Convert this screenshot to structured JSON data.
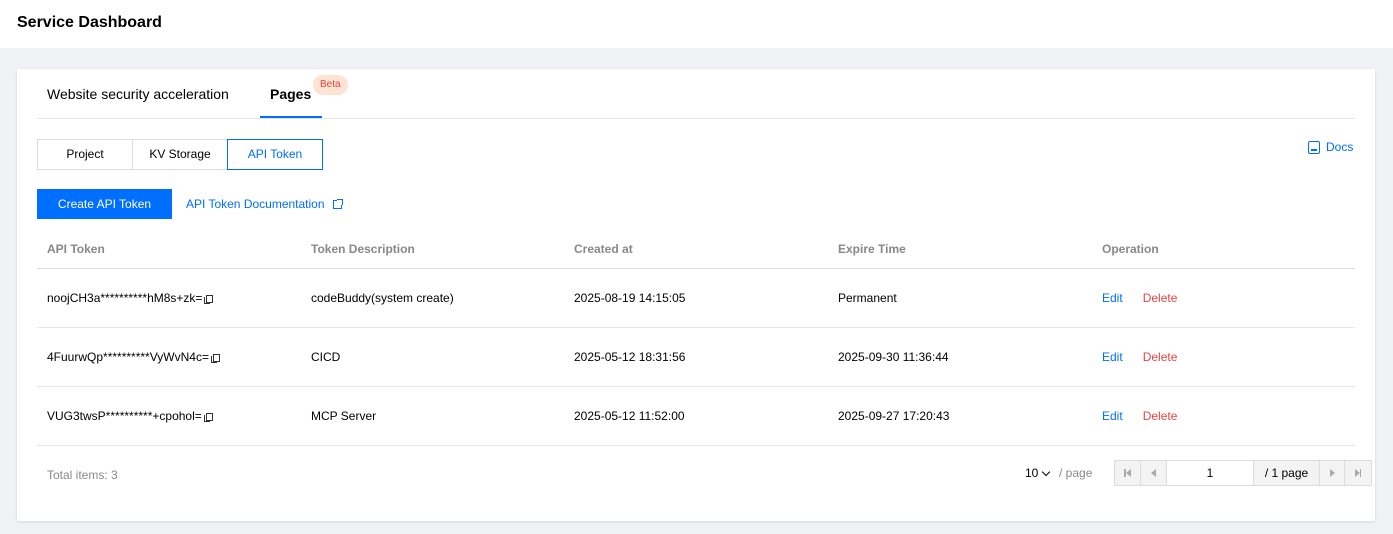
{
  "header": {
    "title": "Service Dashboard"
  },
  "tabs": [
    {
      "label": "Website security acceleration"
    },
    {
      "label": "Pages",
      "badge": "Beta"
    }
  ],
  "segments": [
    "Project",
    "KV Storage",
    "API Token"
  ],
  "docs_label": "Docs",
  "actions": {
    "create_label": "Create API Token",
    "doc_link": "API Token Documentation"
  },
  "table": {
    "columns": [
      "API Token",
      "Token Description",
      "Created at",
      "Expire Time",
      "Operation"
    ],
    "rows": [
      {
        "token": "noojCH3a**********hM8s+zk=",
        "description": "codeBuddy(system create)",
        "created": "2025-08-19 14:15:05",
        "expire": "Permanent",
        "edit": "Edit",
        "delete": "Delete"
      },
      {
        "token": "4FuurwQp**********VyWvN4c=",
        "description": "CICD",
        "created": "2025-05-12 18:31:56",
        "expire": "2025-09-30 11:36:44",
        "edit": "Edit",
        "delete": "Delete"
      },
      {
        "token": "VUG3twsP**********+cpohol=",
        "description": "MCP Server",
        "created": "2025-05-12 11:52:00",
        "expire": "2025-09-27 17:20:43",
        "edit": "Edit",
        "delete": "Delete"
      }
    ]
  },
  "footer": {
    "total": "Total items:  3",
    "page_size": "10",
    "per_page": "/ page",
    "current_page": "1",
    "total_pages": "/ 1 page"
  },
  "colors": {
    "accent": "#006eff",
    "danger": "#e54545",
    "beta_bg": "#fde3d3"
  }
}
